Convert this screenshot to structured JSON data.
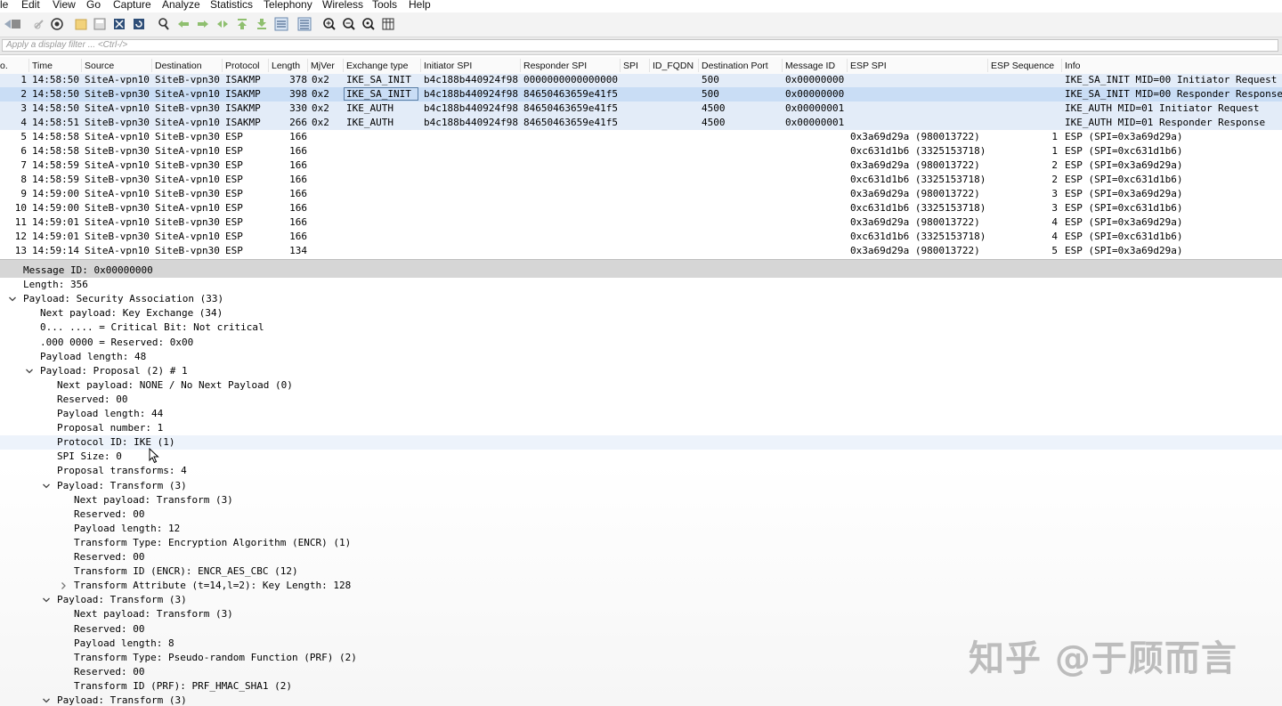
{
  "menu": [
    "le",
    "Edit",
    "View",
    "Go",
    "Capture",
    "Analyze",
    "Statistics",
    "Telephony",
    "Wireless",
    "Tools",
    "Help"
  ],
  "toolbar": {
    "icons": [
      "start-capture-icon",
      "stop-capture-icon",
      "restart-capture-icon",
      "capture-options-icon",
      "open-file-icon",
      "save-file-icon",
      "close-file-icon",
      "reload-file-icon",
      "find-packet-icon",
      "go-back-icon",
      "go-forward-icon",
      "go-to-packet-icon",
      "go-first-icon",
      "go-last-icon",
      "auto-scroll-icon",
      "colorize-icon",
      "zoom-in-icon",
      "zoom-out-icon",
      "zoom-normal-icon",
      "resize-columns-icon"
    ]
  },
  "filter": {
    "placeholder": "Apply a display filter ... <Ctrl-/>"
  },
  "columns": [
    "o.",
    "Time",
    "Source",
    "Destination",
    "Protocol",
    "Length",
    "MjVer",
    "Exchange type",
    "Initiator SPI",
    "Responder SPI",
    "SPI",
    "ID_FQDN",
    "Destination Port",
    "Message ID",
    "ESP SPI",
    "ESP Sequence",
    "Info"
  ],
  "packets": [
    {
      "no": "1",
      "time": "14:58:50",
      "src": "SiteA-vpn10",
      "dst": "SiteB-vpn30",
      "proto": "ISAKMP",
      "len": "378",
      "mjver": "0x2",
      "exch": "IKE_SA_INIT",
      "ispi": "b4c188b440924f98",
      "rspi": "0000000000000000",
      "spi": "",
      "fqdn": "",
      "dport": "500",
      "msgid": "0x00000000",
      "espspi": "",
      "espseq": "",
      "info": "IKE_SA_INIT MID=00 Initiator Request"
    },
    {
      "no": "2",
      "time": "14:58:50",
      "src": "SiteB-vpn30",
      "dst": "SiteA-vpn10",
      "proto": "ISAKMP",
      "len": "398",
      "mjver": "0x2",
      "exch": "IKE_SA_INIT",
      "ispi": "b4c188b440924f98",
      "rspi": "84650463659e41f5",
      "spi": "",
      "fqdn": "",
      "dport": "500",
      "msgid": "0x00000000",
      "espspi": "",
      "espseq": "",
      "info": "IKE_SA_INIT MID=00 Responder Response"
    },
    {
      "no": "3",
      "time": "14:58:50",
      "src": "SiteA-vpn10",
      "dst": "SiteB-vpn30",
      "proto": "ISAKMP",
      "len": "330",
      "mjver": "0x2",
      "exch": "IKE_AUTH",
      "ispi": "b4c188b440924f98",
      "rspi": "84650463659e41f5",
      "spi": "",
      "fqdn": "",
      "dport": "4500",
      "msgid": "0x00000001",
      "espspi": "",
      "espseq": "",
      "info": "IKE_AUTH MID=01 Initiator Request"
    },
    {
      "no": "4",
      "time": "14:58:51",
      "src": "SiteB-vpn30",
      "dst": "SiteA-vpn10",
      "proto": "ISAKMP",
      "len": "266",
      "mjver": "0x2",
      "exch": "IKE_AUTH",
      "ispi": "b4c188b440924f98",
      "rspi": "84650463659e41f5",
      "spi": "",
      "fqdn": "",
      "dport": "4500",
      "msgid": "0x00000001",
      "espspi": "",
      "espseq": "",
      "info": "IKE_AUTH MID=01 Responder Response"
    },
    {
      "no": "5",
      "time": "14:58:58",
      "src": "SiteA-vpn10",
      "dst": "SiteB-vpn30",
      "proto": "ESP",
      "len": "166",
      "mjver": "",
      "exch": "",
      "ispi": "",
      "rspi": "",
      "spi": "",
      "fqdn": "",
      "dport": "",
      "msgid": "",
      "espspi": "0x3a69d29a (980013722)",
      "espseq": "1",
      "info": "ESP (SPI=0x3a69d29a)"
    },
    {
      "no": "6",
      "time": "14:58:58",
      "src": "SiteB-vpn30",
      "dst": "SiteA-vpn10",
      "proto": "ESP",
      "len": "166",
      "mjver": "",
      "exch": "",
      "ispi": "",
      "rspi": "",
      "spi": "",
      "fqdn": "",
      "dport": "",
      "msgid": "",
      "espspi": "0xc631d1b6 (3325153718)",
      "espseq": "1",
      "info": "ESP (SPI=0xc631d1b6)"
    },
    {
      "no": "7",
      "time": "14:58:59",
      "src": "SiteA-vpn10",
      "dst": "SiteB-vpn30",
      "proto": "ESP",
      "len": "166",
      "mjver": "",
      "exch": "",
      "ispi": "",
      "rspi": "",
      "spi": "",
      "fqdn": "",
      "dport": "",
      "msgid": "",
      "espspi": "0x3a69d29a (980013722)",
      "espseq": "2",
      "info": "ESP (SPI=0x3a69d29a)"
    },
    {
      "no": "8",
      "time": "14:58:59",
      "src": "SiteB-vpn30",
      "dst": "SiteA-vpn10",
      "proto": "ESP",
      "len": "166",
      "mjver": "",
      "exch": "",
      "ispi": "",
      "rspi": "",
      "spi": "",
      "fqdn": "",
      "dport": "",
      "msgid": "",
      "espspi": "0xc631d1b6 (3325153718)",
      "espseq": "2",
      "info": "ESP (SPI=0xc631d1b6)"
    },
    {
      "no": "9",
      "time": "14:59:00",
      "src": "SiteA-vpn10",
      "dst": "SiteB-vpn30",
      "proto": "ESP",
      "len": "166",
      "mjver": "",
      "exch": "",
      "ispi": "",
      "rspi": "",
      "spi": "",
      "fqdn": "",
      "dport": "",
      "msgid": "",
      "espspi": "0x3a69d29a (980013722)",
      "espseq": "3",
      "info": "ESP (SPI=0x3a69d29a)"
    },
    {
      "no": "10",
      "time": "14:59:00",
      "src": "SiteB-vpn30",
      "dst": "SiteA-vpn10",
      "proto": "ESP",
      "len": "166",
      "mjver": "",
      "exch": "",
      "ispi": "",
      "rspi": "",
      "spi": "",
      "fqdn": "",
      "dport": "",
      "msgid": "",
      "espspi": "0xc631d1b6 (3325153718)",
      "espseq": "3",
      "info": "ESP (SPI=0xc631d1b6)"
    },
    {
      "no": "11",
      "time": "14:59:01",
      "src": "SiteA-vpn10",
      "dst": "SiteB-vpn30",
      "proto": "ESP",
      "len": "166",
      "mjver": "",
      "exch": "",
      "ispi": "",
      "rspi": "",
      "spi": "",
      "fqdn": "",
      "dport": "",
      "msgid": "",
      "espspi": "0x3a69d29a (980013722)",
      "espseq": "4",
      "info": "ESP (SPI=0x3a69d29a)"
    },
    {
      "no": "12",
      "time": "14:59:01",
      "src": "SiteB-vpn30",
      "dst": "SiteA-vpn10",
      "proto": "ESP",
      "len": "166",
      "mjver": "",
      "exch": "",
      "ispi": "",
      "rspi": "",
      "spi": "",
      "fqdn": "",
      "dport": "",
      "msgid": "",
      "espspi": "0xc631d1b6 (3325153718)",
      "espseq": "4",
      "info": "ESP (SPI=0xc631d1b6)"
    },
    {
      "no": "13",
      "time": "14:59:14",
      "src": "SiteA-vpn10",
      "dst": "SiteB-vpn30",
      "proto": "ESP",
      "len": "134",
      "mjver": "",
      "exch": "",
      "ispi": "",
      "rspi": "",
      "spi": "",
      "fqdn": "",
      "dport": "",
      "msgid": "",
      "espspi": "0x3a69d29a (980013722)",
      "espseq": "5",
      "info": "ESP (SPI=0x3a69d29a)"
    }
  ],
  "selected_packet": "2",
  "details": [
    {
      "level": 0,
      "arrow": "",
      "text": "Message ID: 0x00000000",
      "state": "selected"
    },
    {
      "level": 0,
      "arrow": "",
      "text": "Length: 356",
      "state": ""
    },
    {
      "level": 0,
      "arrow": "open",
      "text": "Payload: Security Association (33)",
      "state": ""
    },
    {
      "level": 1,
      "arrow": "",
      "text": "Next payload: Key Exchange (34)",
      "state": ""
    },
    {
      "level": 1,
      "arrow": "",
      "text": "0... .... = Critical Bit: Not critical",
      "state": ""
    },
    {
      "level": 1,
      "arrow": "",
      "text": ".000 0000 = Reserved: 0x00",
      "state": ""
    },
    {
      "level": 1,
      "arrow": "",
      "text": "Payload length: 48",
      "state": ""
    },
    {
      "level": 1,
      "arrow": "open",
      "text": "Payload: Proposal (2) # 1",
      "state": ""
    },
    {
      "level": 2,
      "arrow": "",
      "text": "Next payload: NONE / No Next Payload  (0)",
      "state": ""
    },
    {
      "level": 2,
      "arrow": "",
      "text": "Reserved: 00",
      "state": ""
    },
    {
      "level": 2,
      "arrow": "",
      "text": "Payload length: 44",
      "state": ""
    },
    {
      "level": 2,
      "arrow": "",
      "text": "Proposal number: 1",
      "state": ""
    },
    {
      "level": 2,
      "arrow": "",
      "text": "Protocol ID: IKE (1)",
      "state": "hover"
    },
    {
      "level": 2,
      "arrow": "",
      "text": "SPI Size: 0",
      "state": ""
    },
    {
      "level": 2,
      "arrow": "",
      "text": "Proposal transforms: 4",
      "state": ""
    },
    {
      "level": 2,
      "arrow": "open",
      "text": "Payload: Transform (3)",
      "state": ""
    },
    {
      "level": 3,
      "arrow": "",
      "text": "Next payload: Transform (3)",
      "state": ""
    },
    {
      "level": 3,
      "arrow": "",
      "text": "Reserved: 00",
      "state": ""
    },
    {
      "level": 3,
      "arrow": "",
      "text": "Payload length: 12",
      "state": ""
    },
    {
      "level": 3,
      "arrow": "",
      "text": "Transform Type: Encryption Algorithm (ENCR) (1)",
      "state": ""
    },
    {
      "level": 3,
      "arrow": "",
      "text": "Reserved: 00",
      "state": ""
    },
    {
      "level": 3,
      "arrow": "",
      "text": "Transform ID (ENCR): ENCR_AES_CBC (12)",
      "state": ""
    },
    {
      "level": 3,
      "arrow": "closed",
      "text": "Transform Attribute (t=14,l=2): Key Length: 128",
      "state": ""
    },
    {
      "level": 2,
      "arrow": "open",
      "text": "Payload: Transform (3)",
      "state": ""
    },
    {
      "level": 3,
      "arrow": "",
      "text": "Next payload: Transform (3)",
      "state": ""
    },
    {
      "level": 3,
      "arrow": "",
      "text": "Reserved: 00",
      "state": ""
    },
    {
      "level": 3,
      "arrow": "",
      "text": "Payload length: 8",
      "state": ""
    },
    {
      "level": 3,
      "arrow": "",
      "text": "Transform Type: Pseudo-random Function (PRF) (2)",
      "state": ""
    },
    {
      "level": 3,
      "arrow": "",
      "text": "Reserved: 00",
      "state": ""
    },
    {
      "level": 3,
      "arrow": "",
      "text": "Transform ID (PRF): PRF_HMAC_SHA1 (2)",
      "state": ""
    },
    {
      "level": 2,
      "arrow": "open",
      "text": "Payload: Transform (3)",
      "state": ""
    }
  ],
  "watermark": "知乎 @于顾而言",
  "colors": {
    "isakmp_row": "#e3ecf8",
    "selected_row": "#c9ddf5",
    "detail_selected": "#d6d6d6"
  }
}
